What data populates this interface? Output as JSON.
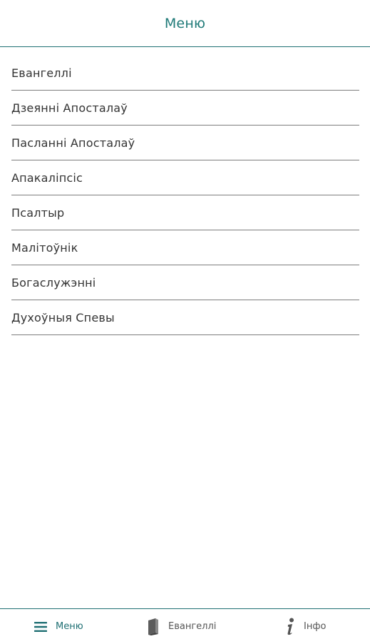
{
  "header": {
    "title": "Меню"
  },
  "menu": {
    "items": [
      {
        "label": "Евангеллі"
      },
      {
        "label": "Дзеянні Апосталаў"
      },
      {
        "label": "Пасланні Апосталаў"
      },
      {
        "label": "Апакаліпсіс"
      },
      {
        "label": "Псалтыр"
      },
      {
        "label": "Малітоўнік"
      },
      {
        "label": "Богаслужэнні"
      },
      {
        "label": "Духоўныя Спевы"
      }
    ]
  },
  "bottom_nav": {
    "tabs": [
      {
        "label": "Меню",
        "icon": "hamburger-menu-icon",
        "active": true
      },
      {
        "label": "Евангеллі",
        "icon": "book-icon",
        "active": false
      },
      {
        "label": "Інфо",
        "icon": "info-icon",
        "active": false
      }
    ]
  },
  "colors": {
    "accent": "#1f6f73",
    "text": "#333333",
    "divider": "#7d7d7d"
  }
}
